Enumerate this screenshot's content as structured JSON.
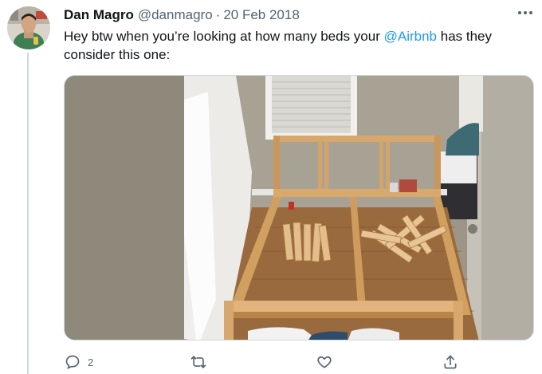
{
  "tweet": {
    "author": {
      "display_name": "Dan Magro",
      "handle": "@danmagro"
    },
    "separator": "·",
    "date": "20 Feb 2018",
    "text_part1": "Hey btw when you’re looking at how many beds your ",
    "mention": "@Airbnb",
    "text_part2": " has they consider this one:",
    "media": {
      "icon": "photo-bed-frame"
    },
    "actions": {
      "reply_icon": "reply-icon",
      "reply_count": "2",
      "retweet_icon": "retweet-icon",
      "like_icon": "like-icon",
      "share_icon": "share-icon"
    },
    "more_icon": "more-icon"
  },
  "colors": {
    "accent": "#1d9bf0",
    "secondary_text": "#536471",
    "primary_text": "#0f1419"
  }
}
